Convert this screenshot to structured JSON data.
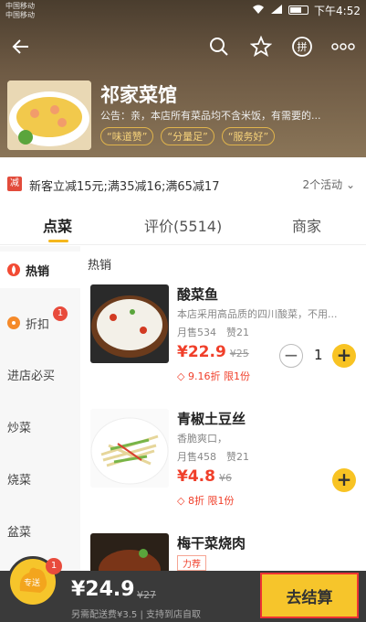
{
  "status_bar": {
    "carrier1": "中国移动",
    "carrier2": "中国移动",
    "time": "下午4:52"
  },
  "shop": {
    "name": "祁家菜馆",
    "notice": "公告：亲，本店所有菜品均不含米饭，有需要的...",
    "tags": [
      "“味道赞”",
      "“分量足”",
      "“服务好”"
    ]
  },
  "promo": {
    "badge": "减",
    "text": "新客立减15元;满35减16;满65减17",
    "more": "2个活动"
  },
  "tabs": [
    {
      "label": "点菜"
    },
    {
      "label": "评价(5514)"
    },
    {
      "label": "商家"
    }
  ],
  "sidebar": {
    "items": [
      {
        "label": "热销"
      },
      {
        "label": "折扣",
        "badge": "1"
      },
      {
        "label": "进店必买"
      },
      {
        "label": "炒菜"
      },
      {
        "label": "烧菜"
      },
      {
        "label": "盆菜"
      }
    ]
  },
  "menu": {
    "section": "热销",
    "dishes": [
      {
        "name": "酸菜鱼",
        "desc": "本店采用高品质的四川酸菜，不用...",
        "sales": "月售534　赞21",
        "price": "¥22.9",
        "orig": "¥25",
        "discount": "9.16折 限1份",
        "qty": "1"
      },
      {
        "name": "青椒土豆丝",
        "desc": "香脆爽口，",
        "sales": "月售458　赞21",
        "price": "¥4.8",
        "orig": "¥6",
        "discount": "8折 限1份"
      },
      {
        "name": "梅干菜烧肉",
        "tag": "力荐"
      }
    ]
  },
  "cart": {
    "badge": "1",
    "label": "专送",
    "total": "¥24.9",
    "orig": "¥27",
    "note": "另需配送费¥3.5 | 支持到店自取",
    "checkout": "去结算"
  }
}
